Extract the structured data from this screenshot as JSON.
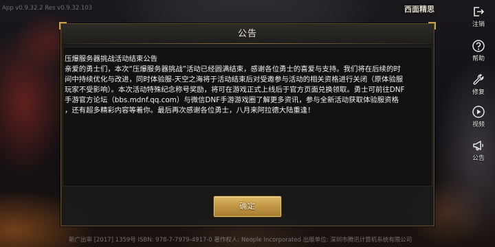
{
  "screen": {
    "version_text": "App v0.9.32.2 Res v0.9.32.103",
    "corner_title": "西面精思",
    "copyright_text": "新广出审 [2017] 1359号 ISBN: 978-7-7979-4917-0 著作权人: Neople Incorporated 出版单位: 深圳市腾讯计算机系统有限公司"
  },
  "side_menu": {
    "items": [
      {
        "label": "注销",
        "icon": "logout-icon"
      },
      {
        "label": "帮助",
        "icon": "help-icon"
      },
      {
        "label": "修复",
        "icon": "wrench-icon"
      },
      {
        "label": "视频",
        "icon": "play-icon"
      },
      {
        "label": "公告",
        "icon": "megaphone-icon"
      }
    ]
  },
  "dialog": {
    "title": "公告",
    "heading": "压爆服务器挑战活动结束公告",
    "body_lines": [
      "亲爱的勇士们，本次“压爆服务器挑战”活动已经圆满结束，感谢各位勇士的喜爱与支持。我们将在后续的时",
      "间中持续优化与改进，同时体验服-天空之海将于活动结束后对受邀参与活动的相关资格进行关闭（原体验服",
      "玩家不受影响）。本次活动特殊纪念称号奖励，将可在游戏正式上线后于官方页面兑换领取。勇士可前往DNF",
      "手游官方论坛（bbs.mdnf.qq.com）与微信DNF手游游戏圈了解更多资讯，参与全新活动获取体验服资格",
      "，还有超多精彩内容等着你。最后再次感谢各位勇士，八月来阿拉德大陆重逢！"
    ],
    "confirm_label": "确定"
  },
  "colors": {
    "accent_gold": "#c9a24e",
    "frame": "#5e4c2f",
    "text": "#f2f2f2"
  }
}
